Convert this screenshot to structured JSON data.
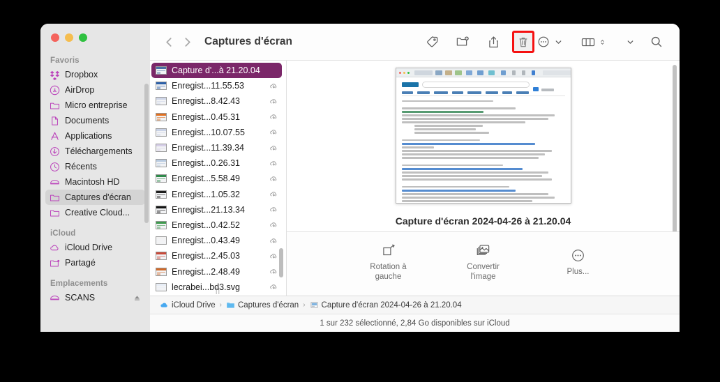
{
  "window": {
    "title": "Captures d'écran",
    "traffic_lights": [
      "close",
      "minimize",
      "zoom"
    ]
  },
  "toolbar": {
    "back_label": "Précédent",
    "forward_label": "Suivant",
    "items": [
      {
        "name": "tag-icon",
        "label": "Étiquettes"
      },
      {
        "name": "new-folder-icon",
        "label": "Nouveau dossier"
      },
      {
        "name": "share-icon",
        "label": "Partager"
      },
      {
        "name": "trash-icon",
        "label": "Supprimer",
        "highlighted": true
      },
      {
        "name": "more-icon",
        "label": "Plus"
      },
      {
        "name": "view-columns-icon",
        "label": "Présentation"
      },
      {
        "name": "group-icon",
        "label": "Grouper"
      },
      {
        "name": "search-icon",
        "label": "Rechercher"
      }
    ],
    "highlight_color": "#f51111"
  },
  "sidebar": {
    "groups": [
      {
        "title": "Favoris",
        "items": [
          {
            "label": "Dropbox",
            "icon": "dropbox-icon"
          },
          {
            "label": "AirDrop",
            "icon": "airdrop-icon"
          },
          {
            "label": "Micro entreprise",
            "icon": "folder-icon"
          },
          {
            "label": "Documents",
            "icon": "document-icon"
          },
          {
            "label": "Applications",
            "icon": "applications-icon"
          },
          {
            "label": "Téléchargements",
            "icon": "downloads-icon"
          },
          {
            "label": "Récents",
            "icon": "clock-icon"
          },
          {
            "label": "Macintosh HD",
            "icon": "disk-icon"
          },
          {
            "label": "Captures d'écran",
            "icon": "folder-icon",
            "active": true
          },
          {
            "label": "Creative Cloud...",
            "icon": "folder-icon"
          }
        ]
      },
      {
        "title": "iCloud",
        "items": [
          {
            "label": "iCloud Drive",
            "icon": "cloud-icon"
          },
          {
            "label": "Partagé",
            "icon": "shared-folder-icon"
          }
        ]
      },
      {
        "title": "Emplacements",
        "items": [
          {
            "label": "SCANS",
            "icon": "disk-icon",
            "eject": true
          }
        ]
      }
    ],
    "accent_color": "#bb44bb",
    "active_bg": "#d4d4d4"
  },
  "file_list": {
    "selection_color": "#7b2769",
    "files": [
      {
        "name": "Capture d'...à 21.20.04",
        "selected": true,
        "cloud": false,
        "thumb": "#4a6fa5"
      },
      {
        "name": "Enregist...11.55.53",
        "cloud": true,
        "thumb": "#2b5fa8"
      },
      {
        "name": "Enregist...8.42.43",
        "cloud": true,
        "thumb": "#cfd6e8"
      },
      {
        "name": "Enregist...0.45.31",
        "cloud": true,
        "thumb": "#e07020"
      },
      {
        "name": "Enregist...10.07.55",
        "cloud": true,
        "thumb": "#c9d2e6"
      },
      {
        "name": "Enregist...11.39.34",
        "cloud": true,
        "thumb": "#d6cfe8"
      },
      {
        "name": "Enregist...0.26.31",
        "cloud": true,
        "thumb": "#b9cbe0"
      },
      {
        "name": "Enregist...5.58.49",
        "cloud": true,
        "thumb": "#2f8a4a"
      },
      {
        "name": "Enregist...1.05.32",
        "cloud": true,
        "thumb": "#1d1d1d"
      },
      {
        "name": "Enregist...21.13.34",
        "cloud": true,
        "thumb": "#141414"
      },
      {
        "name": "Enregist...0.42.52",
        "cloud": true,
        "thumb": "#3f9a4f"
      },
      {
        "name": "Enregist...0.43.49",
        "cloud": true,
        "thumb": "#f2f2f2"
      },
      {
        "name": "Enregist...2.45.03",
        "cloud": true,
        "thumb": "#c94a3a"
      },
      {
        "name": "Enregist...2.48.49",
        "cloud": true,
        "thumb": "#d06a2a"
      },
      {
        "name": "lecrabei...bd3.svg",
        "cloud": true,
        "thumb": "#e8eef6"
      }
    ]
  },
  "preview": {
    "title": "Capture d'écran 2024-04-26 à 21.20.04",
    "actions": [
      {
        "label": "Rotation à gauche",
        "icon": "rotate-left-icon"
      },
      {
        "label": "Convertir l'image",
        "icon": "convert-image-icon"
      },
      {
        "label": "Plus...",
        "icon": "more-circle-icon"
      }
    ]
  },
  "pathbar": {
    "crumbs": [
      {
        "label": "iCloud Drive",
        "icon": "cloud-icon"
      },
      {
        "label": "Captures d'écran",
        "icon": "folder-blue-icon"
      },
      {
        "label": "Capture d'écran 2024-04-26 à 21.20.04",
        "icon": "image-file-icon"
      }
    ],
    "separator": "›"
  },
  "status": {
    "text": "1 sur 232 sélectionné, 2,84 Go disponibles sur iCloud"
  }
}
